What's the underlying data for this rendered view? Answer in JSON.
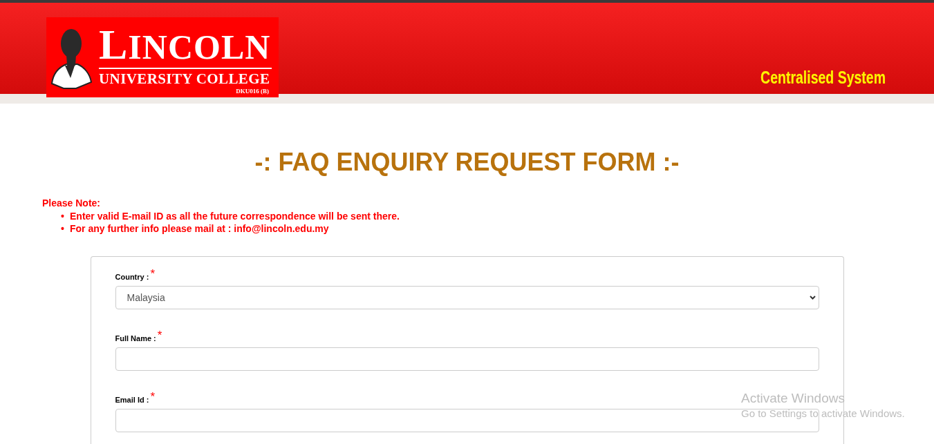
{
  "header": {
    "logo": {
      "name": "LINCOLN",
      "subtitle": "UNIVERSITY COLLEGE",
      "code": "DKU016 (B)"
    },
    "system_name": "Centralised System"
  },
  "form_title": "-: FAQ ENQUIRY REQUEST FORM :-",
  "note": {
    "heading": "Please Note:",
    "items": [
      {
        "marker": "•",
        "text": "Enter valid E-mail ID as all the future correspondence will be sent there."
      },
      {
        "marker": "•",
        "text": "For any further info please mail at : info@lincoln.edu.my"
      }
    ]
  },
  "form": {
    "fields": [
      {
        "kind": "select",
        "label": "Country :",
        "required_mark": "*",
        "value": "Malaysia"
      },
      {
        "kind": "text",
        "label": "Full Name :",
        "required_mark": "*"
      },
      {
        "kind": "text",
        "label": "Email Id :",
        "required_mark": "*"
      }
    ]
  },
  "os_notice": {
    "title": "Activate Windows",
    "message": "Go to Settings to activate Windows."
  }
}
